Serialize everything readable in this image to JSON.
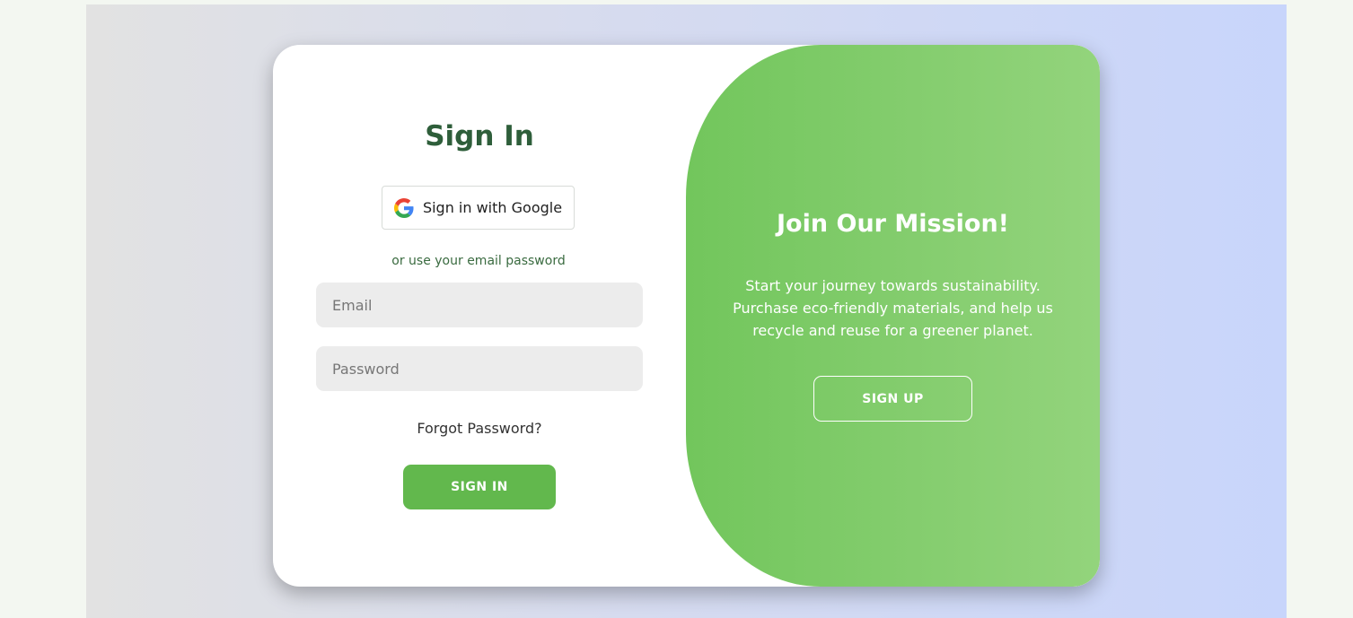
{
  "signin": {
    "title": "Sign In",
    "google_button_label": "Sign in with Google",
    "google_icon": "google-g-icon",
    "alt_text": "or use your email password",
    "email_placeholder": "Email",
    "password_placeholder": "Password",
    "forgot_label": "Forgot Password?",
    "submit_label": "SIGN IN"
  },
  "mission": {
    "title": "Join Our Mission!",
    "line1": "Start your journey towards sustainability.",
    "line2": "Purchase eco-friendly materials, and help us",
    "line3": "recycle and reuse for a greener planet.",
    "signup_label": "SIGN UP"
  },
  "colors": {
    "title_green": "#2e5e3a",
    "button_green": "#62b84d",
    "panel_green": "#84cd6e",
    "field_bg": "#ececec"
  }
}
